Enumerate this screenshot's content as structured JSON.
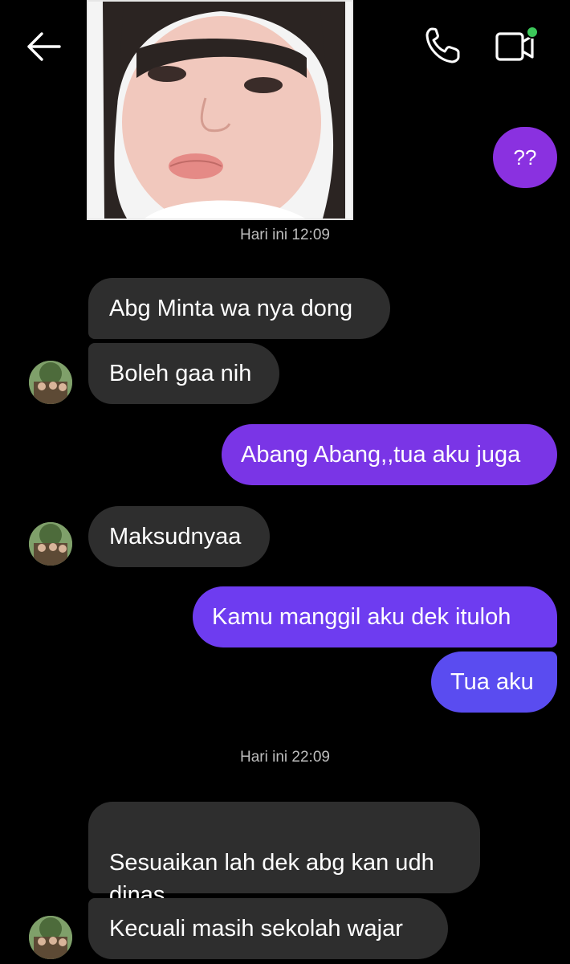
{
  "header": {
    "back_icon": "arrow-left-icon",
    "call_icon": "phone-icon",
    "video_icon": "video-camera-icon",
    "online_indicator_color": "#3cc85a"
  },
  "shared_photo": {
    "description_icon": "photo-of-child"
  },
  "messages": [
    {
      "side": "out",
      "text": "??"
    },
    {
      "kind": "timestamp",
      "text": "Hari ini 12:09"
    },
    {
      "side": "in",
      "text": "Abg Minta wa nya dong"
    },
    {
      "side": "in",
      "text": "Boleh gaa nih"
    },
    {
      "side": "out",
      "text": "Abang Abang,,tua aku juga"
    },
    {
      "side": "in",
      "text": "Maksudnyaa"
    },
    {
      "side": "out",
      "text": "Kamu manggil aku dek ituloh"
    },
    {
      "side": "out",
      "text": "Tua aku"
    },
    {
      "kind": "timestamp",
      "text": "Hari ini 22:09"
    },
    {
      "side": "in",
      "text": "Sesuaikan lah dek abg kan udh\ndinas"
    },
    {
      "side": "in",
      "text": "Kecuali masih sekolah wajar"
    }
  ],
  "colors": {
    "background": "#000000",
    "incoming_bubble": "#2e2e2e",
    "outgoing_purple": "#8a31e0",
    "outgoing_violet": "#6e3cf0",
    "outgoing_blue": "#5a4cf0",
    "timestamp_text": "#bdbdbd"
  }
}
